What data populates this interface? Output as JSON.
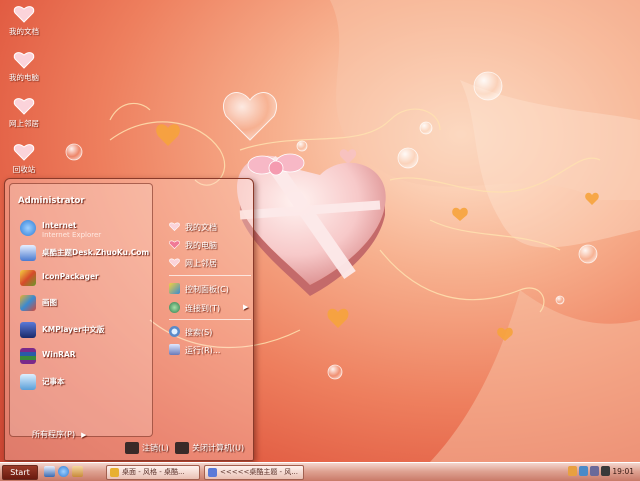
{
  "desktop_icons": [
    {
      "label": "我的文档",
      "icon": "heart-icon"
    },
    {
      "label": "我的电脑",
      "icon": "heart-icon"
    },
    {
      "label": "网上邻居",
      "icon": "heart-icon"
    },
    {
      "label": "回收站",
      "icon": "heart-icon"
    }
  ],
  "start_menu": {
    "user": "Administrator",
    "programs": [
      {
        "title": "Internet",
        "subtitle": "Internet Explorer",
        "icon": "internet-explorer-icon",
        "color": "#2b7bd6"
      },
      {
        "title": "桌酷主题Desk.ZhuoKu.Com",
        "subtitle": "",
        "icon": "zhuoku-icon",
        "color": "#4a7ad0"
      },
      {
        "title": "IconPackager",
        "subtitle": "",
        "icon": "iconpackager-icon",
        "color": "#d64a2a"
      },
      {
        "title": "画图",
        "subtitle": "",
        "icon": "paint-icon",
        "color": "#e8b030"
      },
      {
        "title": "KMPlayer中文版",
        "subtitle": "",
        "icon": "kmplayer-icon",
        "color": "#2a4a9a"
      },
      {
        "title": "WinRAR",
        "subtitle": "",
        "icon": "winrar-icon",
        "color": "#7a2a8a"
      },
      {
        "title": "记事本",
        "subtitle": "",
        "icon": "notepad-icon",
        "color": "#5aa0d8"
      }
    ],
    "all_programs": "所有程序(P)",
    "places": [
      {
        "label": "我的文档",
        "icon": "heart-icon"
      },
      {
        "label": "我的电脑",
        "icon": "heart-icon"
      },
      {
        "label": "网上邻居",
        "icon": "heart-icon"
      }
    ],
    "settings": [
      {
        "label": "控制面板(C)",
        "icon": "control-panel-icon"
      },
      {
        "label": "连接到(T)",
        "icon": "network-globe-icon",
        "has_submenu": true
      }
    ],
    "tools": [
      {
        "label": "搜索(S)",
        "icon": "search-icon"
      },
      {
        "label": "运行(R)...",
        "icon": "run-icon"
      }
    ],
    "logoff": "注销(L)",
    "shutdown": "关闭计算机(U)"
  },
  "taskbar": {
    "start_label": "Start",
    "tasks": [
      {
        "label": "桌面 - 风格 - 桌酷...",
        "icon": "folder-icon"
      },
      {
        "label": "<<<<<桌酷主题 - 风...",
        "icon": "window-icon"
      }
    ],
    "clock": "19:01"
  },
  "colors": {
    "wallpaper_base": "#ee7f5e",
    "heart_pink": "#f7c9c9",
    "ribbon": "#fdeaea",
    "taskbar": "#dfa393"
  }
}
